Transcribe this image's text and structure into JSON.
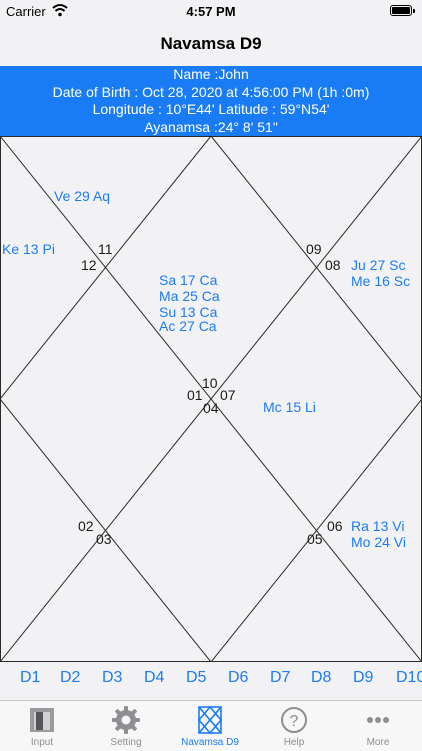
{
  "status": {
    "carrier": "Carrier",
    "time": "4:57 PM"
  },
  "nav": {
    "title": "Navamsa D9"
  },
  "info": {
    "name": "Name :John",
    "dob": "Date of Birth : Oct 28, 2020 at 4:56:00 PM (1h :0m)",
    "coords": "Longitude : 10°E44' Latitude : 59°N54'",
    "ayanamsa": "Ayanamsa :24° 8' 51\""
  },
  "chart": {
    "house_numbers": {
      "h11": "11",
      "h12": "12",
      "h09": "09",
      "h08": "08",
      "h10": "10",
      "h01": "01",
      "h07": "07",
      "h04": "04",
      "h02": "02",
      "h03": "03",
      "h06": "06",
      "h05": "05"
    },
    "planets": {
      "ve": "Ve 29 Aq",
      "ke": "Ke 13 Pi",
      "ju": "Ju 27 Sc",
      "me": "Me 16 Sc",
      "sa": "Sa 17 Ca",
      "ma": "Ma 25 Ca",
      "su": "Su 13 Ca",
      "ac": "Ac 27 Ca",
      "mc": "Mc 15 Li",
      "ra": "Ra 13 Vi",
      "mo": "Mo 24 Vi"
    },
    "colors": {
      "planet_text": "#1a7cf5",
      "line": "#2b2b2b"
    }
  },
  "divisions": [
    "D1",
    "D2",
    "D3",
    "D4",
    "D5",
    "D6",
    "D7",
    "D8",
    "D9",
    "D10"
  ],
  "tabs": [
    {
      "label": "Input",
      "icon": "input-icon"
    },
    {
      "label": "Setting",
      "icon": "gear-icon"
    },
    {
      "label": "Navamsa D9",
      "icon": "navamsa-chart-icon"
    },
    {
      "label": "Help",
      "icon": "help-icon"
    },
    {
      "label": "More",
      "icon": "more-icon"
    }
  ]
}
